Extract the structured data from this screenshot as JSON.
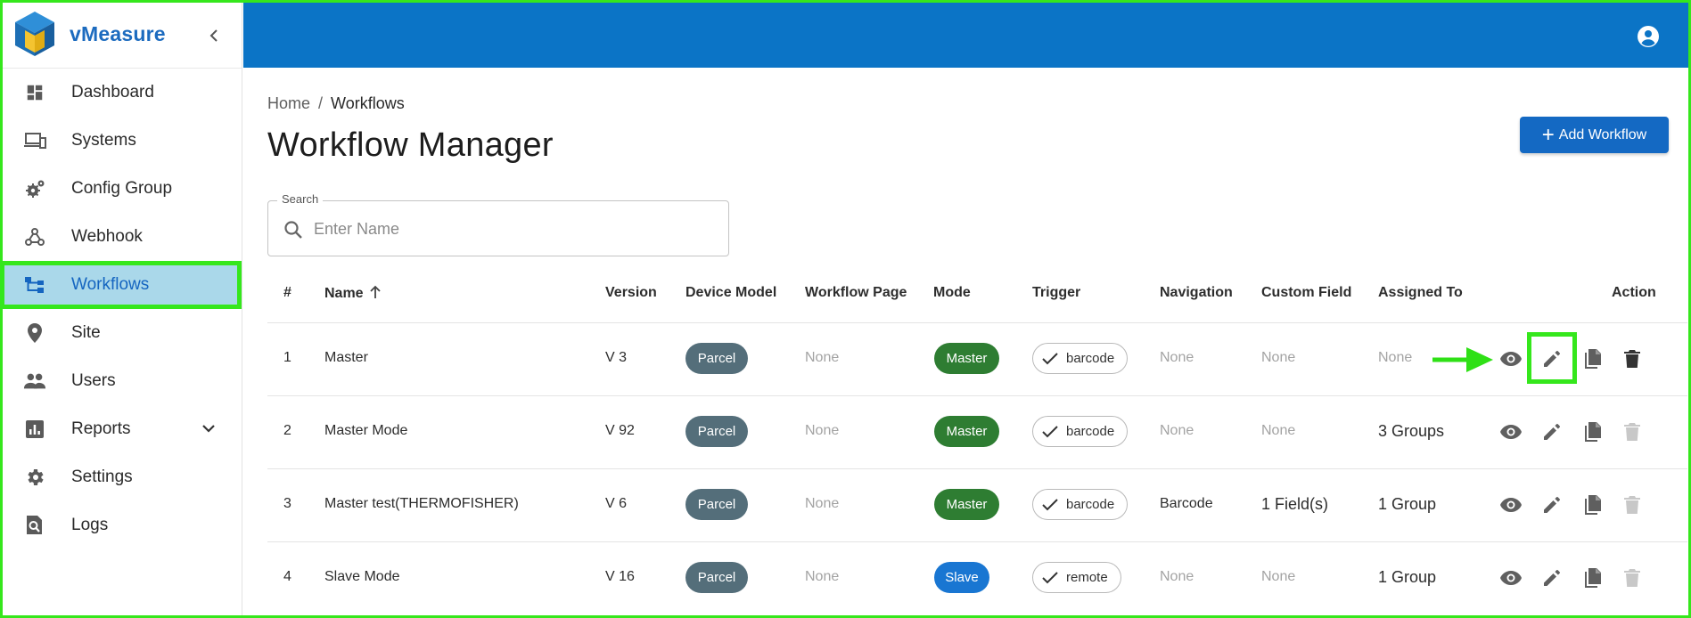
{
  "app": {
    "name": "vMeasure"
  },
  "sidebar": {
    "items": [
      {
        "label": "Dashboard",
        "icon": "dashboard-icon"
      },
      {
        "label": "Systems",
        "icon": "devices-icon"
      },
      {
        "label": "Config Group",
        "icon": "settings-gears-icon"
      },
      {
        "label": "Webhook",
        "icon": "webhook-icon"
      },
      {
        "label": "Workflows",
        "icon": "workflow-icon",
        "active": true
      },
      {
        "label": "Site",
        "icon": "location-pin-icon"
      },
      {
        "label": "Users",
        "icon": "people-icon"
      },
      {
        "label": "Reports",
        "icon": "report-icon",
        "expandable": true
      },
      {
        "label": "Settings",
        "icon": "gear-icon"
      },
      {
        "label": "Logs",
        "icon": "log-search-icon"
      }
    ]
  },
  "breadcrumb": {
    "home": "Home",
    "separator": "/",
    "current": "Workflows"
  },
  "page": {
    "title": "Workflow Manager",
    "add_button": "Add Workflow"
  },
  "search": {
    "label": "Search",
    "placeholder": "Enter Name",
    "value": ""
  },
  "table": {
    "columns": [
      "#",
      "Name",
      "Version",
      "Device Model",
      "Workflow Page",
      "Mode",
      "Trigger",
      "Navigation",
      "Custom Field",
      "Assigned To",
      "Action"
    ],
    "sort": {
      "column": "Name",
      "direction": "asc"
    },
    "rows": [
      {
        "index": "1",
        "name": "Master",
        "version": "V 3",
        "device_model": "Parcel",
        "workflow_page": "None",
        "mode": "Master",
        "trigger": "barcode",
        "navigation": "None",
        "custom_field": "None",
        "assigned_to": "None",
        "delete_enabled": true
      },
      {
        "index": "2",
        "name": "Master Mode",
        "version": "V 92",
        "device_model": "Parcel",
        "workflow_page": "None",
        "mode": "Master",
        "trigger": "barcode",
        "navigation": "None",
        "custom_field": "None",
        "assigned_to": "3 Groups",
        "delete_enabled": false
      },
      {
        "index": "3",
        "name": "Master test(THERMOFISHER)",
        "version": "V 6",
        "device_model": "Parcel",
        "workflow_page": "None",
        "mode": "Master",
        "trigger": "barcode",
        "navigation": "Barcode",
        "custom_field": "1 Field(s)",
        "assigned_to": "1 Group",
        "delete_enabled": false
      },
      {
        "index": "4",
        "name": "Slave Mode",
        "version": "V 16",
        "device_model": "Parcel",
        "workflow_page": "None",
        "mode": "Slave",
        "trigger": "remote",
        "navigation": "None",
        "custom_field": "None",
        "assigned_to": "1 Group",
        "delete_enabled": false
      }
    ]
  },
  "colors": {
    "topbar": "#0b74c6",
    "primary_button": "#1469c3",
    "active_nav": "#aad8ea",
    "highlight": "#35e71c",
    "chip_parcel": "#546e7a",
    "chip_master": "#2e7d32",
    "chip_slave": "#1976d2"
  }
}
